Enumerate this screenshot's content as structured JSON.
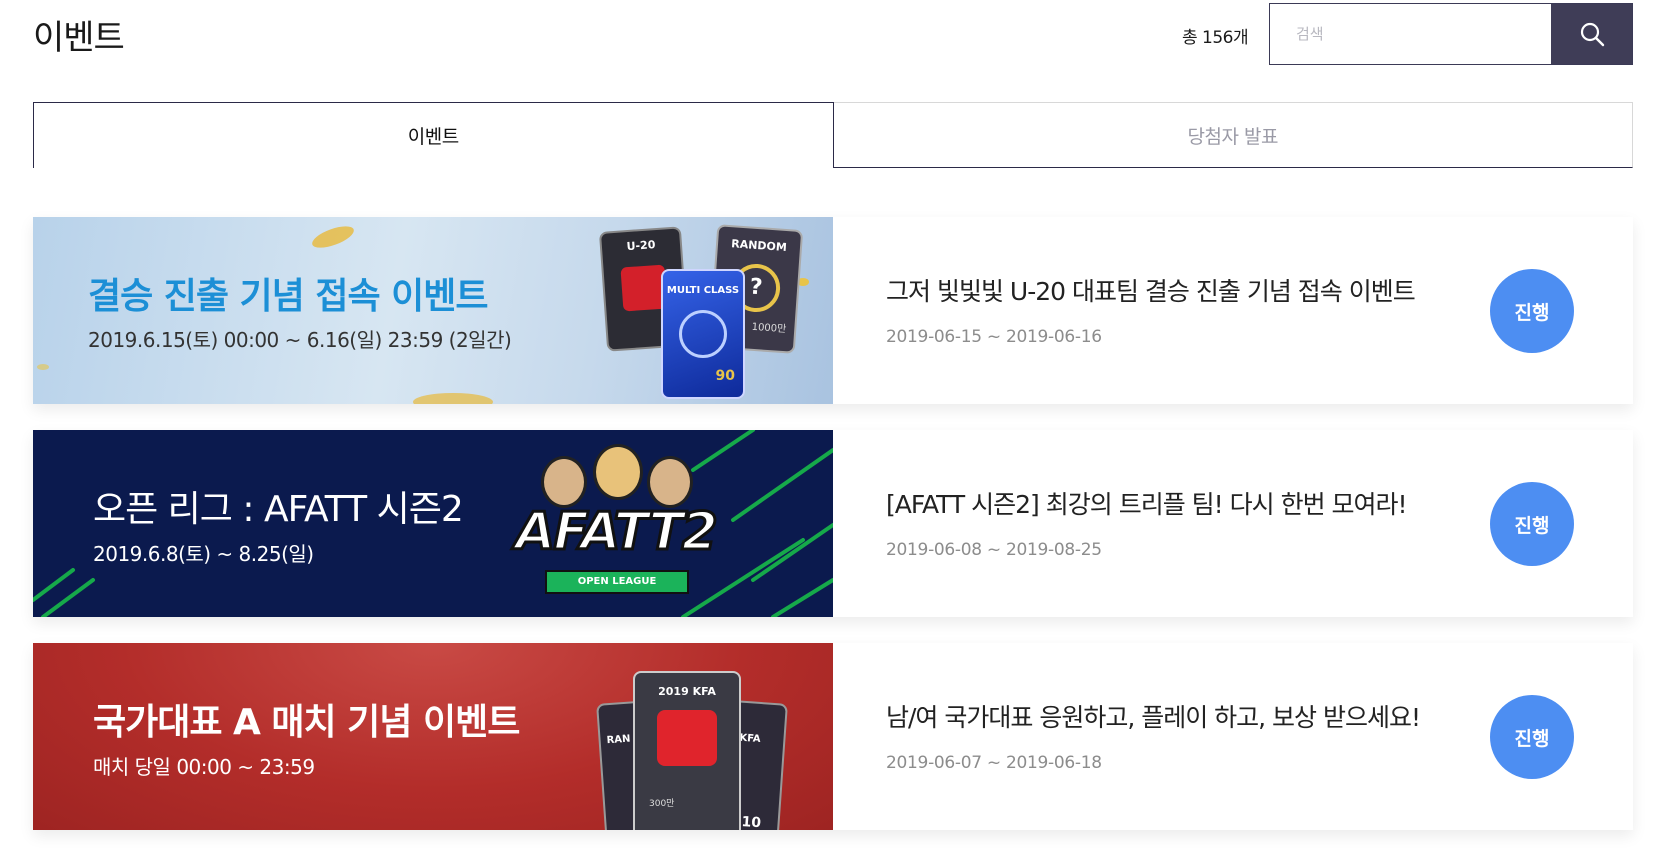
{
  "header": {
    "title": "이벤트",
    "total_count": "총 156개",
    "search": {
      "placeholder": "검색",
      "value": ""
    }
  },
  "tabs": [
    {
      "label": "이벤트",
      "active": true
    },
    {
      "label": "당첨자 발표",
      "active": false
    }
  ],
  "events": [
    {
      "banner_title": "결승 진출 기념 접속 이벤트",
      "banner_subtitle": "2019.6.15(토) 00:00 ~ 6.16(일) 23:59 (2일간)",
      "card_labels": [
        "U-20",
        "RANDOM",
        "MULTI CLASS",
        "1000만",
        "90"
      ],
      "title": "그저 빛빛빛 U-20 대표팀 결승 진출 기념 접속 이벤트",
      "date": "2019-06-15 ~ 2019-06-16",
      "status": "진행"
    },
    {
      "banner_title": "오픈 리그 : AFATT 시즌2",
      "banner_subtitle": "2019.6.8(토) ~ 8.25(일)",
      "logo_text": "AFATT2",
      "logo_ribbon": "OPEN LEAGUE",
      "title": "[AFATT 시즌2] 최강의 트리플 팀! 다시 한번 모여라!",
      "date": "2019-06-08 ~ 2019-08-25",
      "status": "진행"
    },
    {
      "banner_title": "국가대표 A 매치 기념 이벤트",
      "banner_subtitle": "매치 당일 00:00 ~ 23:59",
      "card_labels": [
        "2019 KFA",
        "RAN",
        "KFA",
        "10",
        "300만"
      ],
      "title": "남/여 국가대표 응원하고, 플레이 하고, 보상 받으세요!",
      "date": "2019-06-07 ~ 2019-06-18",
      "status": "진행"
    }
  ],
  "colors": {
    "accent": "#4d8ef2",
    "search_button": "#3f3d57",
    "banner1_title": "#1c8fd6",
    "banner2_bg": "#0b1a4e",
    "banner3_bg": "#b32d2a"
  },
  "icons": {
    "search": "search-icon"
  }
}
